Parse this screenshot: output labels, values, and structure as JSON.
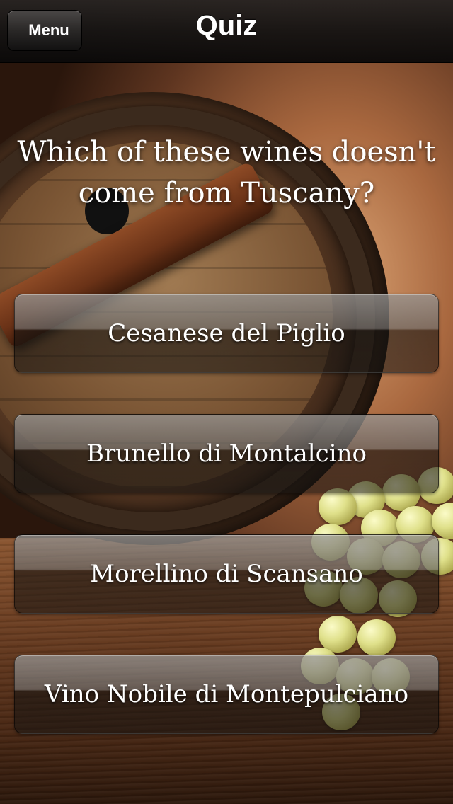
{
  "navbar": {
    "title": "Quiz",
    "back_label": "Menu"
  },
  "quiz": {
    "question": "Which of these wines doesn't come from Tuscany?",
    "answers": [
      "Cesanese del Piglio",
      "Brunello di Montalcino",
      "Morellino di Scansano",
      "Vino Nobile di Montepulciano"
    ]
  },
  "colors": {
    "navbar": "#161413",
    "text": "#ffffff",
    "wood": "#6d3f22",
    "grape": "#dfe08a"
  }
}
